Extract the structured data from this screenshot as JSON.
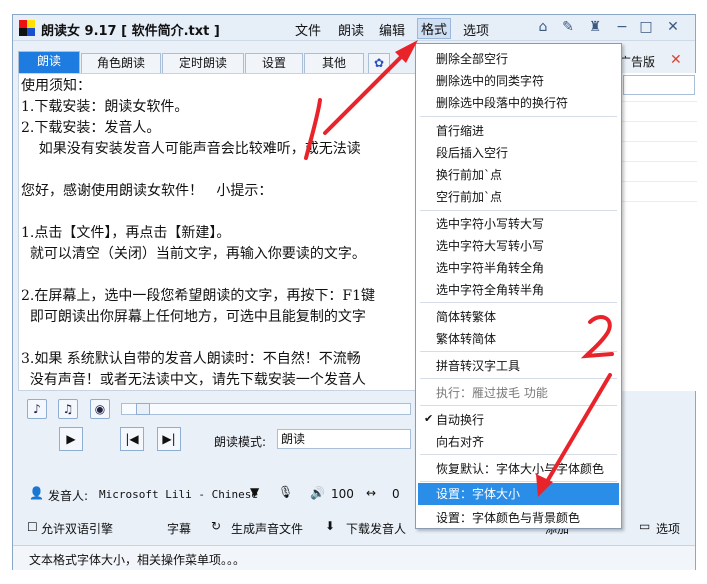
{
  "window": {
    "title": "朗读女 9.17 [ 软件简介.txt ]",
    "menus": [
      "文件",
      "朗读",
      "编辑",
      "格式",
      "选项"
    ]
  },
  "tabs": [
    "朗读",
    "角色朗读",
    "定时朗读",
    "设置",
    "其他"
  ],
  "ad_label": "广告版",
  "editor": {
    "lines": [
      "使用须知：",
      "1.下载安装：朗读女软件。",
      "2.下载安装：发音人。",
      "    如果没有安装发音人可能声音会比较难听，或无法读",
      "",
      "您好，感谢使用朗读女软件！   小提示：",
      "",
      "1.点击【文件】，再点击【新建】。",
      "  就可以清空（关闭）当前文字，再输入你要读的文字。",
      "",
      "2.在屏幕上，选中一段您希望朗读的文字，再按下：F1键",
      "  即可朗读出你屏幕上任何地方，可选中且能复制的文字",
      "",
      "3.如果 系统默认自带的发音人朗读时：不自然！不流畅",
      "  没有声音！或者无法读中文，请先下载安装一个发音人"
    ]
  },
  "controls": {
    "mode_label": "朗读模式:",
    "mode_value": "朗读",
    "voice_label": "发音人:",
    "voice_value": "Microsoft Lili - Chinese",
    "volume": "100",
    "speed": "0",
    "bilingual": "允许双语引擎",
    "subtitle": "字幕",
    "gen_audio": "生成声音文件",
    "download_voice": "下载发音人",
    "add": "添加",
    "options": "选项"
  },
  "status": "文本格式字体大小，相关操作菜单项。。。",
  "format_menu": {
    "items": [
      "删除全部空行",
      "删除选中的同类字符",
      "删除选中段落中的换行符",
      "首行缩进",
      "段后插入空行",
      "换行前加`点",
      "空行前加`点",
      "选中字符小写转大写",
      "选中字符大写转小写",
      "选中字符半角转全角",
      "选中字符全角转半角",
      "简体转繁体",
      "繁体转简体",
      "拼音转汉字工具",
      "执行：雁过拔毛 功能",
      "自动换行",
      "向右对齐",
      "恢复默认：字体大小与字体颜色",
      "设置：字体大小",
      "设置：字体颜色与背景颜色"
    ]
  },
  "annotations": [
    "1",
    "2"
  ],
  "colors": {
    "accent": "#1e7be0",
    "highlight": "#2a8ee8",
    "arrow": "#e8242a"
  }
}
